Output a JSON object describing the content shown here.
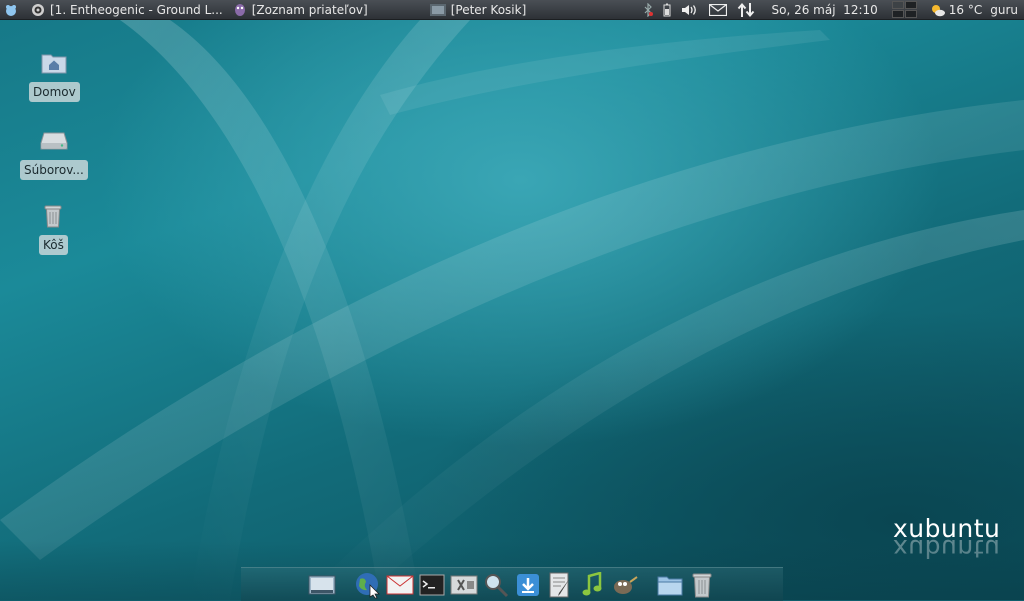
{
  "top_panel": {
    "windows": [
      {
        "label": "[1. Entheogenic - Ground L...",
        "icon": "audacious-icon"
      },
      {
        "label": "[Zoznam priateľov]",
        "icon": "pidgin-icon"
      },
      {
        "label": "[Peter Kosik]",
        "icon": "chat-window-icon"
      }
    ],
    "clock": "So, 26 máj  12:10",
    "weather": "16 °C",
    "user": "guru"
  },
  "desktop": {
    "icons": [
      {
        "label": "Domov",
        "icon": "home-folder-icon"
      },
      {
        "label": "Súborov...",
        "icon": "drive-icon"
      },
      {
        "label": "Kôš",
        "icon": "trash-icon"
      }
    ]
  },
  "brand": {
    "text": "xubuntu"
  },
  "dock": {
    "items": [
      "show-desktop-icon",
      "web-browser-icon",
      "mail-icon",
      "terminal-icon",
      "settings-icon",
      "search-icon",
      "download-icon",
      "text-editor-icon",
      "music-player-icon",
      "gimp-icon",
      "file-manager-icon",
      "trash-icon"
    ]
  },
  "colors": {
    "panel": "#2d3136",
    "wallpaper": "#167887",
    "label_bg": "#c8d6d8"
  }
}
